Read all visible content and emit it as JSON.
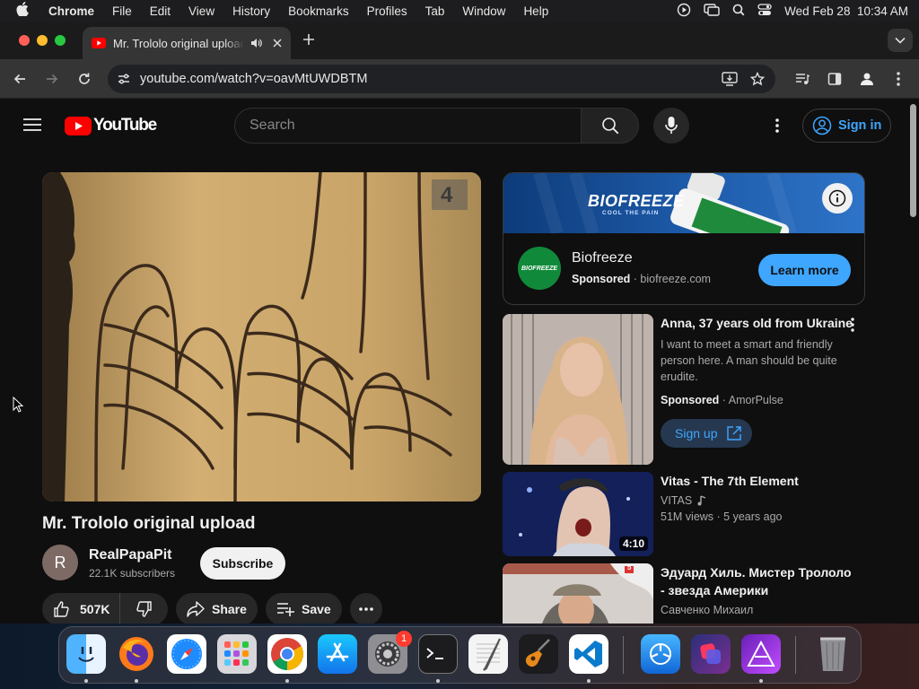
{
  "menubar": {
    "items": [
      "Chrome",
      "File",
      "Edit",
      "View",
      "History",
      "Bookmarks",
      "Profiles",
      "Tab",
      "Window",
      "Help"
    ],
    "datetime": "Wed Feb 28  10:34 AM"
  },
  "browser": {
    "tab_title": "Mr. Trololo original upload",
    "url": "youtube.com/watch?v=oavMtUWDBTM"
  },
  "youtube": {
    "logo_text": "YouTube",
    "search_placeholder": "Search",
    "sign_in_label": "Sign in"
  },
  "video": {
    "title": "Mr. Trololo original upload",
    "channel_initial": "R",
    "channel_name": "RealPapaPit",
    "subscribers": "22.1K subscribers",
    "subscribe_label": "Subscribe",
    "likes": "507K",
    "share_label": "Share",
    "save_label": "Save",
    "channel_bug": "4"
  },
  "ad": {
    "banner_brand": "BIOFREEZE",
    "banner_tagline": "COOL THE PAIN",
    "name": "Biofreeze",
    "sponsored": "Sponsored",
    "domain": "biofreeze.com",
    "cta": "Learn more"
  },
  "recommendations": [
    {
      "title": "Anna, 37 years old from Ukraine",
      "description": "I want to meet a smart and friendly person here. A man should be quite erudite.",
      "sponsored": "Sponsored",
      "advertiser": "AmorPulse",
      "cta": "Sign up"
    },
    {
      "title": "Vitas - The 7th Element",
      "channel": "VITAS",
      "views": "51M views",
      "age": "5 years ago",
      "duration": "4:10"
    },
    {
      "title": "Эдуард Хиль. Мистер Трололо - звезда Америки",
      "channel": "Савченко Михаил",
      "thumb_caption": "5"
    }
  ],
  "dock": {
    "settings_badge": "1",
    "apps": [
      "finder",
      "firefox",
      "safari",
      "launchpad",
      "chrome",
      "app-store",
      "system-settings",
      "terminal",
      "textedit",
      "garageband",
      "vscode",
      "testflight",
      "shortcuts",
      "affinity",
      "trash"
    ]
  },
  "colors": {
    "youtube_red": "#ff0000",
    "link_blue": "#3ea6ff",
    "cta_blue": "#3ea6ff",
    "background": "#0f0f0f"
  }
}
